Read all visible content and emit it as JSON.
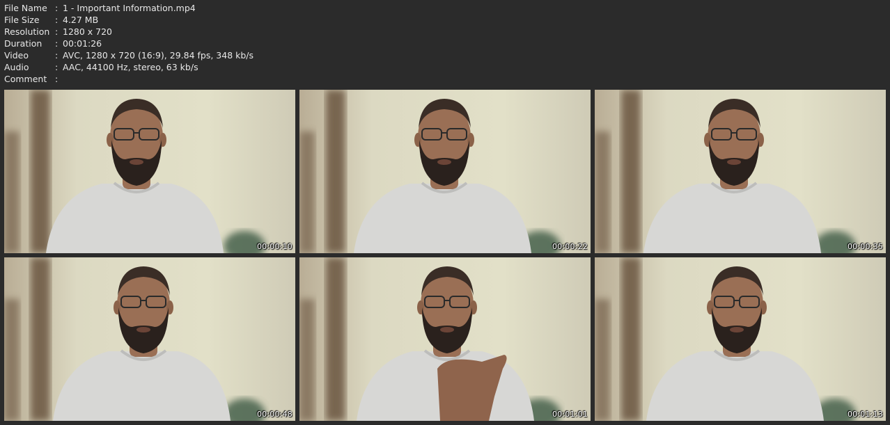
{
  "info": [
    {
      "label": "File Name",
      "value": "1 - Important Information.mp4"
    },
    {
      "label": "File Size",
      "value": "4.27 MB"
    },
    {
      "label": "Resolution",
      "value": "1280 x 720"
    },
    {
      "label": "Duration",
      "value": "00:01:26"
    },
    {
      "label": "Video",
      "value": "AVC, 1280 x 720 (16:9), 29.84 fps, 348 kb/s"
    },
    {
      "label": "Audio",
      "value": "AAC, 44100 Hz, stereo, 63 kb/s"
    },
    {
      "label": "Comment",
      "value": ""
    }
  ],
  "separator": ":",
  "thumbnails": [
    {
      "timestamp": "00:00:10"
    },
    {
      "timestamp": "00:00:22"
    },
    {
      "timestamp": "00:00:35"
    },
    {
      "timestamp": "00:00:48"
    },
    {
      "timestamp": "00:01:01"
    },
    {
      "timestamp": "00:01:13"
    }
  ],
  "colors": {
    "background": "#2b2b2b",
    "text": "#e8e8e8",
    "wall": "#e2e0c8",
    "shirt": "#d7d7d5",
    "skin": "#9a6f55",
    "beard": "#2a211d"
  }
}
